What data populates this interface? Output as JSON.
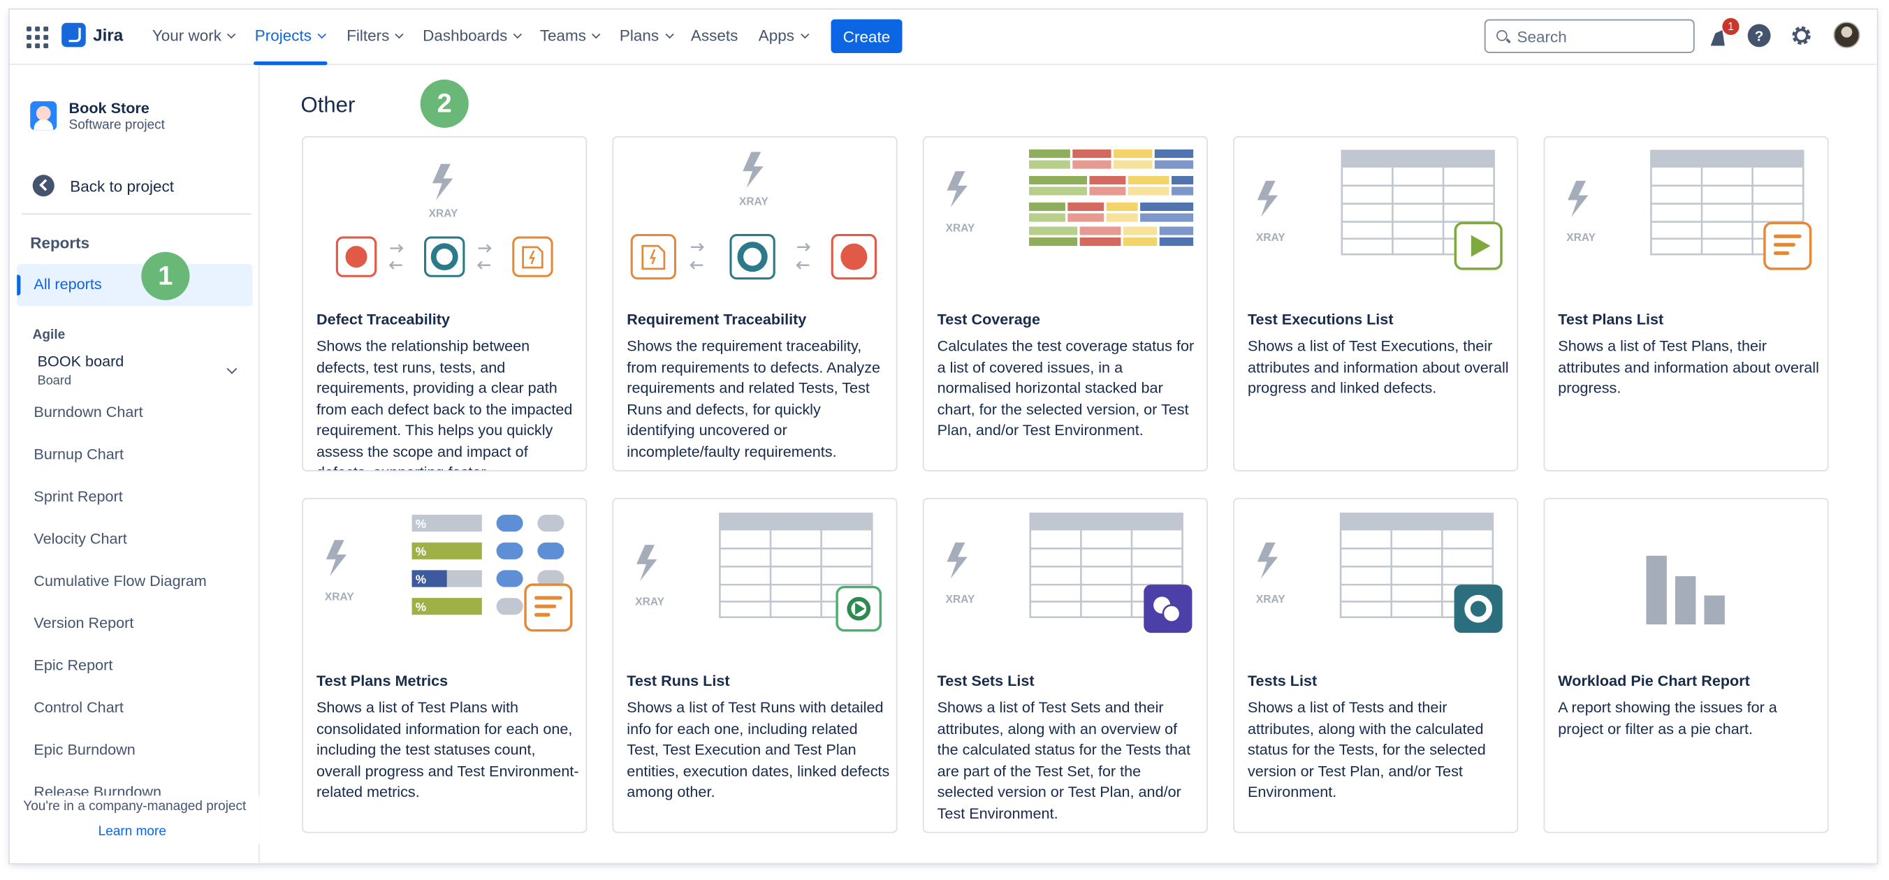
{
  "nav": {
    "logo": "Jira",
    "items": [
      "Your work",
      "Projects",
      "Filters",
      "Dashboards",
      "Teams",
      "Plans",
      "Assets",
      "Apps"
    ],
    "create_label": "Create",
    "search_placeholder": "Search",
    "notification_count": "1",
    "help_glyph": "?"
  },
  "sidebar": {
    "project_name": "Book Store",
    "project_type": "Software project",
    "back_label": "Back to project",
    "reports_heading": "Reports",
    "all_reports_label": "All reports",
    "agile_heading": "Agile",
    "board_name": "BOOK board",
    "board_type": "Board",
    "items": [
      "Burndown Chart",
      "Burnup Chart",
      "Sprint Report",
      "Velocity Chart",
      "Cumulative Flow Diagram",
      "Version Report",
      "Epic Report",
      "Control Chart",
      "Epic Burndown",
      "Release Burndown"
    ],
    "company_note": "You're in a company-managed project",
    "learn_more": "Learn more"
  },
  "markers": [
    "1",
    "2"
  ],
  "main": {
    "section_title": "Other",
    "xray_word": "XRAY",
    "cards": [
      {
        "title": "Defect Traceability",
        "description": "Shows the relationship between defects, test runs, tests, and requirements, providing a clear path from each defect back to the impacted requirement. This helps you quickly assess the scope and impact of defects, supporting faster"
      },
      {
        "title": "Requirement Traceability",
        "description": "Shows the requirement traceability, from requirements to defects. Analyze requirements and related Tests, Test Runs and defects, for quickly identifying uncovered or incomplete/faulty requirements."
      },
      {
        "title": "Test Coverage",
        "description": "Calculates the test coverage status for a list of covered issues, in a normalised horizontal stacked bar chart, for the selected version, or Test Plan, and/or Test Environment."
      },
      {
        "title": "Test Executions List",
        "description": "Shows a list of Test Executions, their attributes and information about overall progress and linked defects."
      },
      {
        "title": "Test Plans List",
        "description": "Shows a list of Test Plans, their attributes and information about overall progress."
      },
      {
        "title": "Test Plans Metrics",
        "description": "Shows a list of Test Plans with consolidated information for each one, including the test statuses count, overall progress and Test Environment-related metrics."
      },
      {
        "title": "Test Runs List",
        "description": "Shows a list of Test Runs with detailed info for each one, including related Test, Test Execution and Test Plan entities, execution dates, linked defects among other."
      },
      {
        "title": "Test Sets List",
        "description": "Shows a list of Test Sets and their attributes, along with an overview of the calculated status for the Tests that are part of the Test Set, for the selected version or Test Plan, and/or Test Environment."
      },
      {
        "title": "Tests List",
        "description": "Shows a list of Tests and their attributes, along with the calculated status for the Tests, for the selected version or Test Plan, and/or Test Environment."
      },
      {
        "title": "Workload Pie Chart Report",
        "description": "A report showing the issues for a project or filter as a pie chart."
      }
    ],
    "metric_label": "%"
  },
  "colors": {
    "brand_blue": "#0c66e4",
    "step_green": "#6ab877",
    "defect_red": "#e05a47",
    "teal": "#2b7a8a",
    "orange": "#e38a3a",
    "xray_grey": "#a5adba"
  }
}
